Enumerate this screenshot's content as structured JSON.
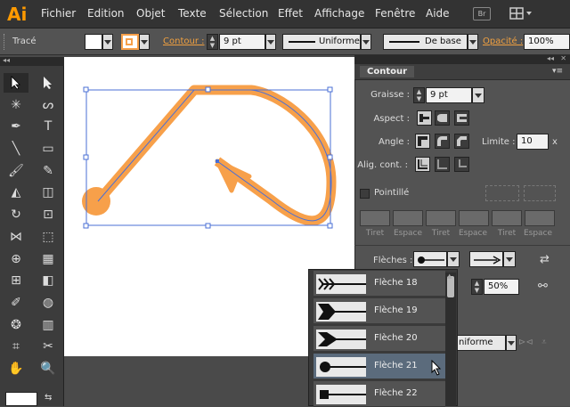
{
  "app": {
    "logo": "Ai",
    "bridge_label": "Br"
  },
  "menu": [
    "Fichier",
    "Edition",
    "Objet",
    "Texte",
    "Sélection",
    "Effet",
    "Affichage",
    "Fenêtre",
    "Aide"
  ],
  "control": {
    "object_type": "Tracé",
    "contour_label": "Contour :",
    "stroke_weight": "9 pt",
    "stroke_style": "Uniforme",
    "brush": "De base",
    "opacity_label": "Opacité :",
    "opacity": "100%",
    "fill_color": "#ffffff",
    "stroke_color": "#f7a04a"
  },
  "contour_panel": {
    "title": "Contour",
    "graisse_label": "Graisse :",
    "graisse_value": "9 pt",
    "aspect_label": "Aspect :",
    "angle_label": "Angle :",
    "limite_label": "Limite :",
    "limite_value": "10",
    "limite_unit": "x",
    "alig_label": "Alig. cont. :",
    "pointille_label": "Pointillé",
    "dash_labels": [
      "Tiret",
      "Espace",
      "Tiret",
      "Espace",
      "Tiret",
      "Espace"
    ],
    "fleches_label": "Flèches :",
    "scale_value": "50%",
    "profile_value": "niforme"
  },
  "arrow_list": {
    "items": [
      "Flèche 18",
      "Flèche 19",
      "Flèche 20",
      "Flèche 21",
      "Flèche 22"
    ],
    "selected": "Flèche 21"
  },
  "colors": {
    "accent": "#ff9a00",
    "path": "#f7a04a",
    "selection": "#4a6fd6"
  }
}
